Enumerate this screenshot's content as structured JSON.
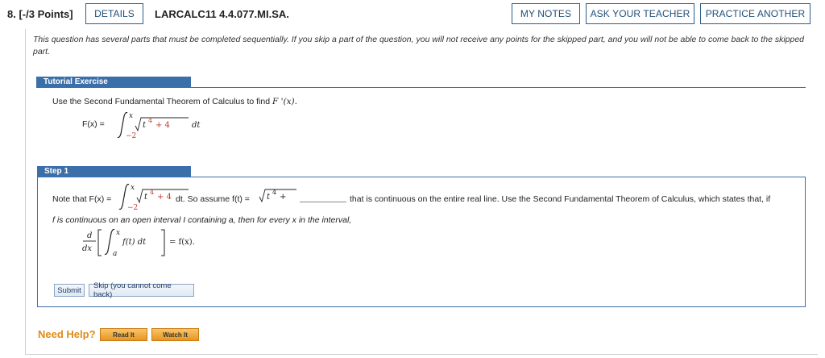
{
  "header": {
    "question_number": "8. [-/3 Points]",
    "details_label": "DETAILS",
    "question_code": "LARCALC11 4.4.077.MI.SA.",
    "my_notes_label": "MY NOTES",
    "ask_teacher_label": "ASK YOUR TEACHER",
    "practice_another_label": "PRACTICE ANOTHER"
  },
  "warning_text": "This question has several parts that must be completed sequentially. If you skip a part of the question, you will not receive any points for the skipped part, and you will not be able to come back to the skipped part.",
  "tutorial": {
    "bar_label": "Tutorial Exercise",
    "instruction_prefix": "Use the Second Fundamental Theorem of Calculus to find ",
    "instruction_fn": "F '(x).",
    "def_lhs": "F(x) =",
    "lower_limit": "−2",
    "upper_limit": "x",
    "integrand_base": "t",
    "integrand_exp": "4",
    "integrand_tail": "+ 4",
    "dt": "dt"
  },
  "step1": {
    "bar_label": "Step 1",
    "note_prefix": "Note that F(x) =",
    "lower_limit": "−2",
    "upper_limit": "x",
    "integrand_base": "t",
    "integrand_exp": "4",
    "integrand_tail": "+ 4",
    "so_assume": "dt. So assume f(t) =",
    "input_prefix_base": "t",
    "input_prefix_exp": "4",
    "input_prefix_plus": "+",
    "answer_value": "",
    "continuous_text": "that is continuous on the entire real line. Use the Second Fundamental Theorem of Calculus, which states that, if",
    "line2": "f is continuous on an open interval I containing a, then for every x in the interval,",
    "deriv_d": "d",
    "deriv_dx": "dx",
    "thm_upper": "x",
    "thm_lower": "a",
    "thm_integrand": "f(t) dt",
    "thm_rhs": "= f(x).",
    "submit_label": "Submit",
    "skip_label": "Skip (you cannot come back)"
  },
  "help": {
    "label": "Need Help?",
    "read_label": "Read It",
    "watch_label": "Watch It"
  },
  "colors": {
    "section_bar": "#3b6faa",
    "accent_text": "#1f4e79",
    "help_orange": "#e08a17",
    "red_digits": "#c0392b"
  }
}
